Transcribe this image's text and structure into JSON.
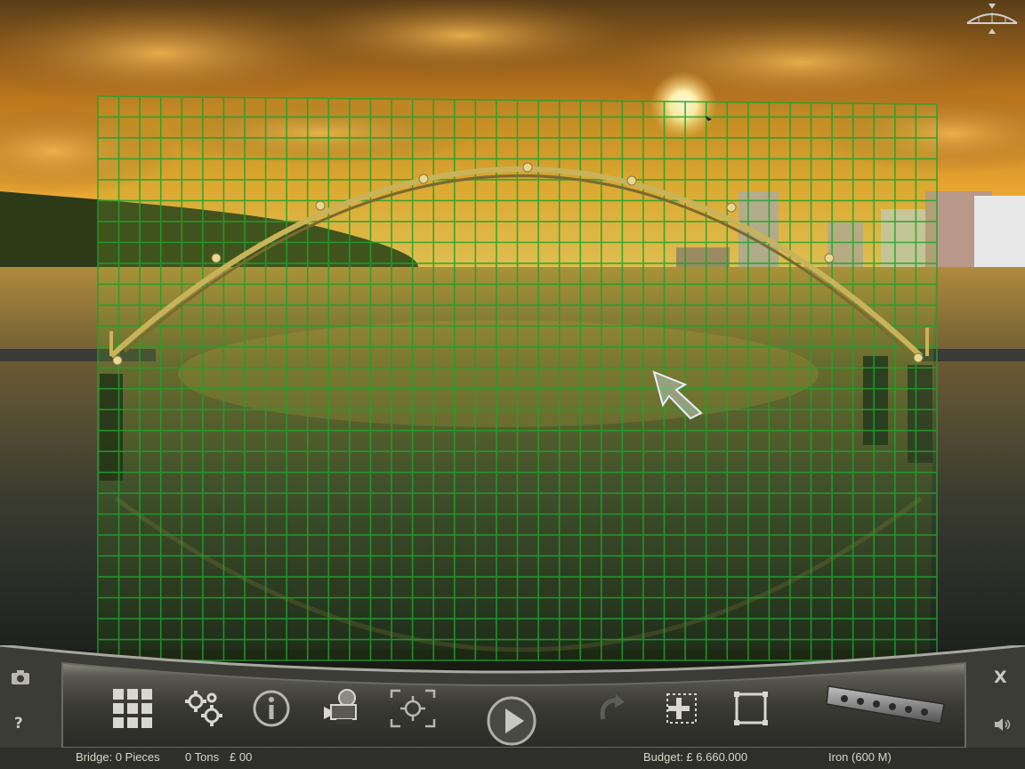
{
  "scene": {
    "sky_top": "#6b4a1a",
    "sky_mid": "#d88a1c",
    "horizon": "#f2b43c",
    "water": "#2b2f26",
    "grid_color": "#1fa22a",
    "arch_color": "#c9b35a"
  },
  "top_right": {
    "icon": "bridge-logo-icon"
  },
  "toolbar": {
    "tools": [
      {
        "name": "menu-grid-button",
        "icon": "grid-menu-icon"
      },
      {
        "name": "settings-button",
        "icon": "gears-icon"
      },
      {
        "name": "info-button",
        "icon": "info-icon"
      },
      {
        "name": "camera-view-button",
        "icon": "movie-camera-icon"
      },
      {
        "name": "focus-button",
        "icon": "crosshair-icon"
      },
      {
        "name": "play-button",
        "icon": "play-icon"
      },
      {
        "name": "undo-button",
        "icon": "undo-icon"
      },
      {
        "name": "add-piece-button",
        "icon": "add-selection-icon"
      },
      {
        "name": "select-button",
        "icon": "square-select-icon"
      },
      {
        "name": "material-beam-button",
        "icon": "iron-beam-icon"
      }
    ]
  },
  "side": {
    "close_label": "X",
    "help_label": "?"
  },
  "status": {
    "bridge": "Bridge: 0 Pieces",
    "tons": "0 Tons",
    "cost": "£ 00",
    "budget": "Budget: £ 6.660.000",
    "material": "Iron (600 M)"
  }
}
